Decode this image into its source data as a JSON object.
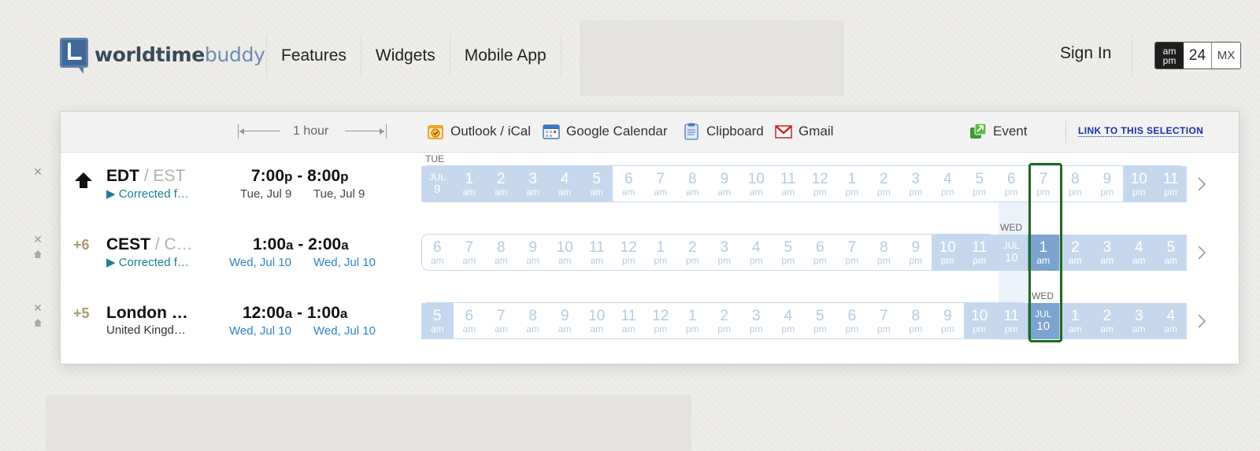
{
  "logo": {
    "part1": "worldtime",
    "part2": "buddy"
  },
  "nav": [
    "Features",
    "Widgets",
    "Mobile App"
  ],
  "sign_in": "Sign In",
  "time_format": {
    "am": "am",
    "pm": "pm",
    "h24": "24",
    "mx": "MX"
  },
  "toolbar": {
    "hour_label": "1 hour",
    "outlook": "Outlook / iCal",
    "google": "Google Calendar",
    "clipboard": "Clipboard",
    "gmail": "Gmail",
    "event": "Event",
    "link": "LINK TO THIS SELECTION"
  },
  "rows": [
    {
      "offset": "",
      "name": "EDT",
      "alt": " / EST",
      "sub": "▶ Corrected f…",
      "start": "7:00",
      "start_suffix": "p",
      "end": "8:00",
      "end_suffix": "p",
      "start_date": "Tue, Jul 9",
      "end_date": "Tue, Jul 9",
      "day_label": "TUE",
      "cells": [
        {
          "n": "JUL",
          "s": "9",
          "k": "date"
        },
        {
          "n": "1",
          "s": "am",
          "k": "mid"
        },
        {
          "n": "2",
          "s": "am",
          "k": "mid"
        },
        {
          "n": "3",
          "s": "am",
          "k": "mid"
        },
        {
          "n": "4",
          "s": "am",
          "k": "mid"
        },
        {
          "n": "5",
          "s": "am",
          "k": "mid"
        },
        {
          "n": "6",
          "s": "am",
          "k": "light"
        },
        {
          "n": "7",
          "s": "am",
          "k": "light"
        },
        {
          "n": "8",
          "s": "am",
          "k": "light"
        },
        {
          "n": "9",
          "s": "am",
          "k": "light"
        },
        {
          "n": "10",
          "s": "am",
          "k": "light"
        },
        {
          "n": "11",
          "s": "am",
          "k": "light"
        },
        {
          "n": "12",
          "s": "pm",
          "k": "light"
        },
        {
          "n": "1",
          "s": "pm",
          "k": "light"
        },
        {
          "n": "2",
          "s": "pm",
          "k": "light"
        },
        {
          "n": "3",
          "s": "pm",
          "k": "light"
        },
        {
          "n": "4",
          "s": "pm",
          "k": "light"
        },
        {
          "n": "5",
          "s": "pm",
          "k": "light"
        },
        {
          "n": "6",
          "s": "pm",
          "k": "light"
        },
        {
          "n": "7",
          "s": "pm",
          "k": "light"
        },
        {
          "n": "8",
          "s": "pm",
          "k": "light"
        },
        {
          "n": "9",
          "s": "pm",
          "k": "light"
        },
        {
          "n": "10",
          "s": "pm",
          "k": "mid"
        },
        {
          "n": "11",
          "s": "pm",
          "k": "mid"
        }
      ]
    },
    {
      "offset": "+6",
      "name": "CEST",
      "alt": " / C…",
      "sub": "▶ Corrected f…",
      "start": "1:00",
      "start_suffix": "a",
      "end": "2:00",
      "end_suffix": "a",
      "start_date": "Wed, Jul 10",
      "end_date": "Wed, Jul 10",
      "day_label": "WED",
      "cells": [
        {
          "n": "6",
          "s": "am",
          "k": "light"
        },
        {
          "n": "7",
          "s": "am",
          "k": "light"
        },
        {
          "n": "8",
          "s": "am",
          "k": "light"
        },
        {
          "n": "9",
          "s": "am",
          "k": "light"
        },
        {
          "n": "10",
          "s": "am",
          "k": "light"
        },
        {
          "n": "11",
          "s": "am",
          "k": "light"
        },
        {
          "n": "12",
          "s": "pm",
          "k": "light"
        },
        {
          "n": "1",
          "s": "pm",
          "k": "light"
        },
        {
          "n": "2",
          "s": "pm",
          "k": "light"
        },
        {
          "n": "3",
          "s": "pm",
          "k": "light"
        },
        {
          "n": "4",
          "s": "pm",
          "k": "light"
        },
        {
          "n": "5",
          "s": "pm",
          "k": "light"
        },
        {
          "n": "6",
          "s": "pm",
          "k": "light"
        },
        {
          "n": "7",
          "s": "pm",
          "k": "light"
        },
        {
          "n": "8",
          "s": "pm",
          "k": "light"
        },
        {
          "n": "9",
          "s": "pm",
          "k": "light"
        },
        {
          "n": "10",
          "s": "pm",
          "k": "mid"
        },
        {
          "n": "11",
          "s": "pm",
          "k": "mid"
        },
        {
          "n": "JUL",
          "s": "10",
          "k": "date"
        },
        {
          "n": "1",
          "s": "am",
          "k": "dark"
        },
        {
          "n": "2",
          "s": "am",
          "k": "mid"
        },
        {
          "n": "3",
          "s": "am",
          "k": "mid"
        },
        {
          "n": "4",
          "s": "am",
          "k": "mid"
        },
        {
          "n": "5",
          "s": "am",
          "k": "mid"
        }
      ]
    },
    {
      "offset": "+5",
      "name": "London …",
      "alt": "",
      "sub": "United Kingd…",
      "start": "12:00",
      "start_suffix": "a",
      "end": "1:00",
      "end_suffix": "a",
      "start_date": "Wed, Jul 10",
      "end_date": "Wed, Jul 10",
      "day_label": "WED",
      "cells": [
        {
          "n": "5",
          "s": "am",
          "k": "mid"
        },
        {
          "n": "6",
          "s": "am",
          "k": "light"
        },
        {
          "n": "7",
          "s": "am",
          "k": "light"
        },
        {
          "n": "8",
          "s": "am",
          "k": "light"
        },
        {
          "n": "9",
          "s": "am",
          "k": "light"
        },
        {
          "n": "10",
          "s": "am",
          "k": "light"
        },
        {
          "n": "11",
          "s": "am",
          "k": "light"
        },
        {
          "n": "12",
          "s": "pm",
          "k": "light"
        },
        {
          "n": "1",
          "s": "pm",
          "k": "light"
        },
        {
          "n": "2",
          "s": "pm",
          "k": "light"
        },
        {
          "n": "3",
          "s": "pm",
          "k": "light"
        },
        {
          "n": "4",
          "s": "pm",
          "k": "light"
        },
        {
          "n": "5",
          "s": "pm",
          "k": "light"
        },
        {
          "n": "6",
          "s": "pm",
          "k": "light"
        },
        {
          "n": "7",
          "s": "pm",
          "k": "light"
        },
        {
          "n": "8",
          "s": "pm",
          "k": "light"
        },
        {
          "n": "9",
          "s": "pm",
          "k": "light"
        },
        {
          "n": "10",
          "s": "pm",
          "k": "mid"
        },
        {
          "n": "11",
          "s": "pm",
          "k": "mid"
        },
        {
          "n": "JUL",
          "s": "10",
          "k": "date-dark"
        },
        {
          "n": "1",
          "s": "am",
          "k": "mid"
        },
        {
          "n": "2",
          "s": "am",
          "k": "mid"
        },
        {
          "n": "3",
          "s": "am",
          "k": "mid"
        },
        {
          "n": "4",
          "s": "am",
          "k": "mid"
        }
      ]
    }
  ],
  "colors": {
    "mid": "#c6d8ee",
    "dark": "#7da4d0",
    "light_text": "#b6cbe0",
    "selection": "#1b6b1b",
    "link": "#1a2fa8"
  },
  "icons": [
    "logo-clock-icon",
    "calendar-ical-icon",
    "google-calendar-icon",
    "clipboard-icon",
    "gmail-icon",
    "event-icon",
    "close-icon",
    "home-icon",
    "up-arrow-icon",
    "chevron-right-icon"
  ]
}
